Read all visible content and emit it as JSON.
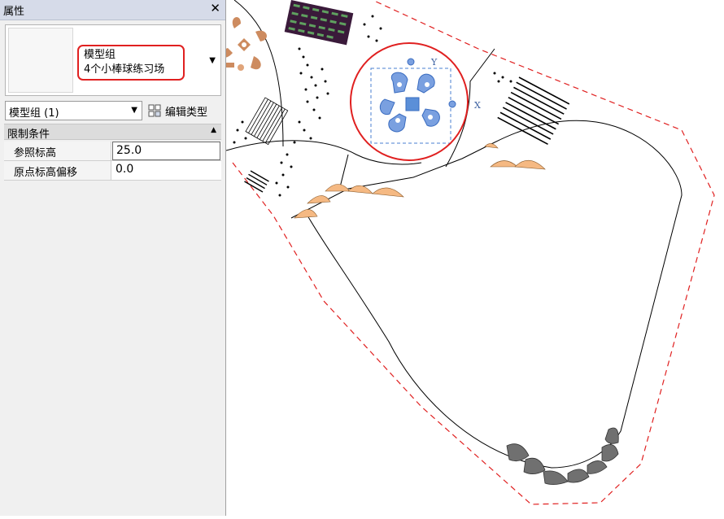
{
  "panel": {
    "title": "属性",
    "close_glyph": "✕"
  },
  "type_selector": {
    "family": "模型组",
    "type": "4个小棒球练习场",
    "highlight_color": "#e02020"
  },
  "instance": {
    "selected": "模型组 (1)",
    "edit_type_label": "编辑类型"
  },
  "constraints": {
    "header": "限制条件",
    "rows": [
      {
        "label": "参照标高",
        "value": "25.0"
      },
      {
        "label": "原点标高偏移",
        "value": "0.0"
      }
    ]
  },
  "canvas": {
    "axis_y": "Y",
    "axis_x": "X",
    "selection_color": "#4a7fd0",
    "group_fill": "#7aa0e0",
    "boundary_color": "#e02020",
    "sand_color": "#f5b983",
    "rock_color": "#707070",
    "diamond_color": "#cd8b5f"
  }
}
